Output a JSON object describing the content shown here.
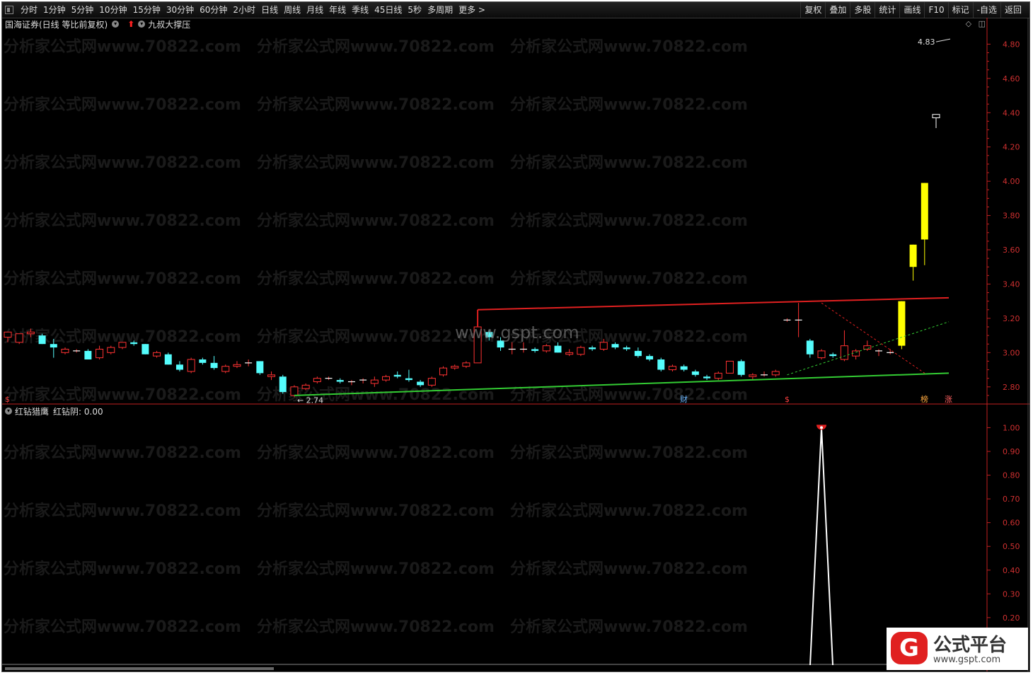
{
  "toolbar": {
    "periods": [
      "分时",
      "1分钟",
      "5分钟",
      "10分钟",
      "15分钟",
      "30分钟",
      "60分钟",
      "2小时",
      "日线",
      "周线",
      "月线",
      "年线",
      "季线",
      "45日线",
      "5秒",
      "多周期",
      "更多 >"
    ],
    "actions": [
      "复权",
      "叠加",
      "多股",
      "统计",
      "画线",
      "F10",
      "标记",
      "-自选",
      "返回"
    ]
  },
  "main_panel": {
    "title": "国海证券(日线 等比前复权)",
    "indicator_name": "九叔大撑压",
    "price_high_label": "4.83",
    "price_low_label": "2.74",
    "markers": {
      "left_dollar": "$",
      "cai": "财",
      "mid_dollar": "$",
      "bang": "榜",
      "zhang": "涨"
    },
    "watermark": "分析家公式网www.70822.com",
    "watermark2": "www.gspt.com",
    "colors": {
      "up": "#ff3232",
      "down": "#54fcfc",
      "resistance": "#e02020",
      "support": "#33cc33",
      "highlight": "#ffff00",
      "axis": "#d03030"
    }
  },
  "sub_panel": {
    "title": "红钻猎鹰",
    "value_label": "红钻阴: 0.00"
  },
  "logo": {
    "title": "公式平台",
    "url": "www.gspt.com"
  },
  "chart_data": {
    "type": "candlestick",
    "main_y_axis": {
      "ticks": [
        4.8,
        4.6,
        4.4,
        4.2,
        4.0,
        3.8,
        3.6,
        3.4,
        3.2,
        3.0,
        2.8
      ],
      "ylim": [
        2.7,
        4.88
      ]
    },
    "candles": [
      {
        "o": 3.09,
        "h": 3.12,
        "l": 3.06,
        "c": 3.12
      },
      {
        "o": 3.06,
        "h": 3.11,
        "l": 3.05,
        "c": 3.11
      },
      {
        "o": 3.11,
        "h": 3.14,
        "l": 3.09,
        "c": 3.12
      },
      {
        "o": 3.1,
        "h": 3.11,
        "l": 3.05,
        "c": 3.05
      },
      {
        "o": 3.05,
        "h": 3.08,
        "l": 2.97,
        "c": 3.03
      },
      {
        "o": 3.0,
        "h": 3.03,
        "l": 2.99,
        "c": 3.02
      },
      {
        "o": 3.01,
        "h": 3.02,
        "l": 3.0,
        "c": 3.01
      },
      {
        "o": 3.01,
        "h": 3.02,
        "l": 2.96,
        "c": 2.96
      },
      {
        "o": 2.97,
        "h": 3.04,
        "l": 2.96,
        "c": 3.02
      },
      {
        "o": 3.0,
        "h": 3.04,
        "l": 2.99,
        "c": 3.03
      },
      {
        "o": 3.03,
        "h": 3.06,
        "l": 3.02,
        "c": 3.06
      },
      {
        "o": 3.06,
        "h": 3.07,
        "l": 3.04,
        "c": 3.05
      },
      {
        "o": 3.05,
        "h": 3.05,
        "l": 2.99,
        "c": 2.99
      },
      {
        "o": 2.98,
        "h": 3.01,
        "l": 2.97,
        "c": 3.0
      },
      {
        "o": 2.99,
        "h": 3.0,
        "l": 2.93,
        "c": 2.93
      },
      {
        "o": 2.93,
        "h": 2.95,
        "l": 2.89,
        "c": 2.9
      },
      {
        "o": 2.89,
        "h": 2.97,
        "l": 2.88,
        "c": 2.96
      },
      {
        "o": 2.96,
        "h": 2.97,
        "l": 2.93,
        "c": 2.94
      },
      {
        "o": 2.94,
        "h": 2.98,
        "l": 2.9,
        "c": 2.91
      },
      {
        "o": 2.89,
        "h": 2.93,
        "l": 2.88,
        "c": 2.92
      },
      {
        "o": 2.92,
        "h": 2.95,
        "l": 2.91,
        "c": 2.93
      },
      {
        "o": 2.94,
        "h": 2.96,
        "l": 2.92,
        "c": 2.94
      },
      {
        "o": 2.95,
        "h": 2.95,
        "l": 2.87,
        "c": 2.88
      },
      {
        "o": 2.86,
        "h": 2.89,
        "l": 2.84,
        "c": 2.87
      },
      {
        "o": 2.86,
        "h": 2.87,
        "l": 2.76,
        "c": 2.77
      },
      {
        "o": 2.75,
        "h": 2.81,
        "l": 2.74,
        "c": 2.8
      },
      {
        "o": 2.79,
        "h": 2.82,
        "l": 2.78,
        "c": 2.81
      },
      {
        "o": 2.83,
        "h": 2.86,
        "l": 2.82,
        "c": 2.85
      },
      {
        "o": 2.85,
        "h": 2.86,
        "l": 2.84,
        "c": 2.85
      },
      {
        "o": 2.84,
        "h": 2.85,
        "l": 2.82,
        "c": 2.83
      },
      {
        "o": 2.83,
        "h": 2.84,
        "l": 2.81,
        "c": 2.83
      },
      {
        "o": 2.84,
        "h": 2.85,
        "l": 2.82,
        "c": 2.84
      },
      {
        "o": 2.82,
        "h": 2.86,
        "l": 2.8,
        "c": 2.84
      },
      {
        "o": 2.84,
        "h": 2.87,
        "l": 2.83,
        "c": 2.86
      },
      {
        "o": 2.87,
        "h": 2.89,
        "l": 2.85,
        "c": 2.86
      },
      {
        "o": 2.85,
        "h": 2.9,
        "l": 2.83,
        "c": 2.84
      },
      {
        "o": 2.83,
        "h": 2.84,
        "l": 2.8,
        "c": 2.81
      },
      {
        "o": 2.81,
        "h": 2.86,
        "l": 2.8,
        "c": 2.85
      },
      {
        "o": 2.87,
        "h": 2.92,
        "l": 2.86,
        "c": 2.91
      },
      {
        "o": 2.91,
        "h": 2.93,
        "l": 2.9,
        "c": 2.92
      },
      {
        "o": 2.92,
        "h": 2.95,
        "l": 2.91,
        "c": 2.94
      },
      {
        "o": 2.94,
        "h": 3.15,
        "l": 2.94,
        "c": 3.15
      },
      {
        "o": 3.12,
        "h": 3.13,
        "l": 3.07,
        "c": 3.09
      },
      {
        "o": 3.07,
        "h": 3.09,
        "l": 3.01,
        "c": 3.03
      },
      {
        "o": 3.02,
        "h": 3.06,
        "l": 2.99,
        "c": 3.02
      },
      {
        "o": 3.02,
        "h": 3.06,
        "l": 3.0,
        "c": 3.02
      },
      {
        "o": 3.02,
        "h": 3.03,
        "l": 3.0,
        "c": 3.01
      },
      {
        "o": 3.01,
        "h": 3.05,
        "l": 3.0,
        "c": 3.04
      },
      {
        "o": 3.04,
        "h": 3.06,
        "l": 3.0,
        "c": 3.0
      },
      {
        "o": 2.99,
        "h": 3.02,
        "l": 2.98,
        "c": 3.0
      },
      {
        "o": 2.99,
        "h": 3.04,
        "l": 2.98,
        "c": 3.03
      },
      {
        "o": 3.03,
        "h": 3.04,
        "l": 3.01,
        "c": 3.02
      },
      {
        "o": 3.02,
        "h": 3.08,
        "l": 3.01,
        "c": 3.06
      },
      {
        "o": 3.05,
        "h": 3.06,
        "l": 3.02,
        "c": 3.03
      },
      {
        "o": 3.03,
        "h": 3.04,
        "l": 3.01,
        "c": 3.02
      },
      {
        "o": 3.01,
        "h": 3.03,
        "l": 2.97,
        "c": 2.98
      },
      {
        "o": 2.98,
        "h": 2.99,
        "l": 2.95,
        "c": 2.96
      },
      {
        "o": 2.96,
        "h": 2.97,
        "l": 2.89,
        "c": 2.9
      },
      {
        "o": 2.9,
        "h": 2.93,
        "l": 2.89,
        "c": 2.92
      },
      {
        "o": 2.92,
        "h": 2.93,
        "l": 2.89,
        "c": 2.9
      },
      {
        "o": 2.89,
        "h": 2.9,
        "l": 2.86,
        "c": 2.87
      },
      {
        "o": 2.86,
        "h": 2.87,
        "l": 2.84,
        "c": 2.85
      },
      {
        "o": 2.85,
        "h": 2.89,
        "l": 2.84,
        "c": 2.88
      },
      {
        "o": 2.88,
        "h": 2.95,
        "l": 2.88,
        "c": 2.95
      },
      {
        "o": 2.95,
        "h": 2.96,
        "l": 2.86,
        "c": 2.87
      },
      {
        "o": 2.86,
        "h": 2.88,
        "l": 2.84,
        "c": 2.87
      },
      {
        "o": 2.87,
        "h": 2.89,
        "l": 2.86,
        "c": 2.87
      },
      {
        "o": 2.87,
        "h": 2.9,
        "l": 2.86,
        "c": 2.89
      },
      {
        "o": 3.19,
        "h": 3.2,
        "l": 3.18,
        "c": 3.19
      },
      {
        "o": 3.19,
        "h": 3.29,
        "l": 3.09,
        "c": 3.19
      },
      {
        "o": 3.07,
        "h": 3.08,
        "l": 2.97,
        "c": 2.99
      },
      {
        "o": 2.97,
        "h": 3.02,
        "l": 2.96,
        "c": 3.01
      },
      {
        "o": 2.99,
        "h": 3.0,
        "l": 2.97,
        "c": 2.98
      },
      {
        "o": 2.96,
        "h": 3.13,
        "l": 2.95,
        "c": 3.04
      },
      {
        "o": 2.98,
        "h": 3.02,
        "l": 2.96,
        "c": 3.01
      },
      {
        "o": 3.02,
        "h": 3.07,
        "l": 3.01,
        "c": 3.04
      },
      {
        "o": 3.01,
        "h": 3.02,
        "l": 2.98,
        "c": 3.01
      },
      {
        "o": 3.0,
        "h": 3.02,
        "l": 2.99,
        "c": 3.0
      },
      {
        "o": 3.04,
        "h": 3.3,
        "l": 3.02,
        "c": 3.3,
        "hl": true
      },
      {
        "o": 3.5,
        "h": 3.63,
        "l": 3.42,
        "c": 3.63,
        "hl": true
      },
      {
        "o": 3.66,
        "h": 3.99,
        "l": 3.51,
        "c": 3.99,
        "hl": true
      },
      {
        "o": 4.37,
        "h": 4.39,
        "l": 4.31,
        "c": 4.39,
        "flat": true
      }
    ],
    "resistance_line": {
      "from": 3.25,
      "to": 3.32
    },
    "support_line": {
      "from": 2.75,
      "to": 2.88
    },
    "sub_y_axis": {
      "ticks": [
        1.0,
        0.9,
        0.8,
        0.7,
        0.6,
        0.5,
        0.4,
        0.3,
        0.2
      ],
      "ylim": [
        0.0,
        1.04
      ]
    },
    "signal_series": {
      "name": "红钻阴",
      "peak": 1.0
    }
  }
}
